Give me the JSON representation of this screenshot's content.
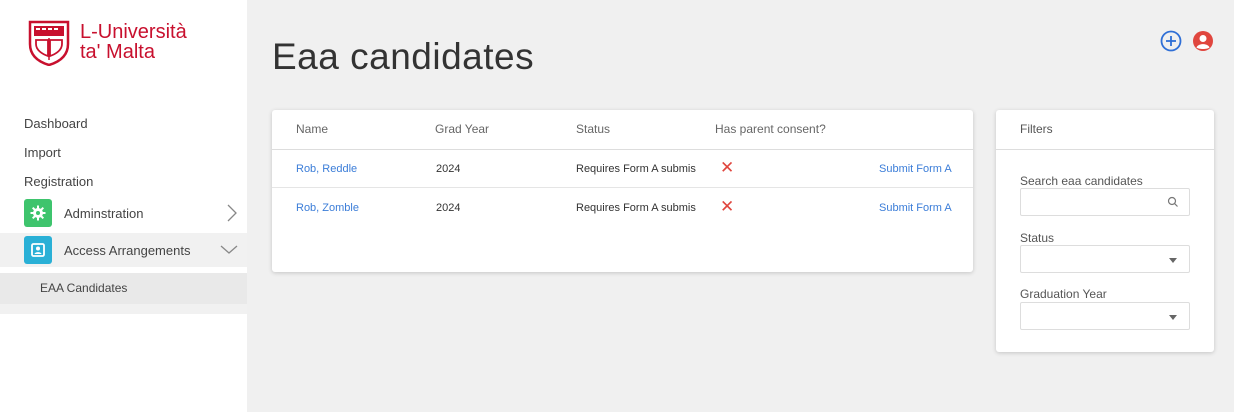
{
  "brand": {
    "line1": "L-Università",
    "line2": "ta' Malta",
    "color": "#c8102e"
  },
  "sidebar": {
    "items": [
      {
        "label": "Dashboard"
      },
      {
        "label": "Import"
      },
      {
        "label": "Registration"
      },
      {
        "label": "Adminstration",
        "icon": "gear-icon"
      },
      {
        "label": "Access Arrangements",
        "icon": "badge-icon"
      }
    ],
    "sub_items": [
      {
        "label": "EAA Candidates"
      }
    ]
  },
  "header": {
    "title": "Eaa candidates"
  },
  "table": {
    "columns": [
      "Name",
      "Grad Year",
      "Status",
      "Has parent consent?"
    ],
    "rows": [
      {
        "name": "Rob, Reddle",
        "grad_year": "2024",
        "status": "Requires Form A submission",
        "consent": "✕",
        "action": "Submit Form A"
      },
      {
        "name": "Rob, Zomble",
        "grad_year": "2024",
        "status": "Requires Form A submission",
        "consent": "✕",
        "action": "Submit Form A"
      }
    ]
  },
  "filters": {
    "title": "Filters",
    "search_label": "Search eaa candidates",
    "search_value": "",
    "status_label": "Status",
    "status_value": "",
    "grad_year_label": "Graduation Year",
    "grad_year_value": ""
  },
  "colors": {
    "link": "#3b7dd8",
    "error": "#e0463e",
    "green_icon": "#3ec46d",
    "blue_icon": "#2ab0d6",
    "add": "#2f6fd6",
    "profile": "#e0463e"
  }
}
